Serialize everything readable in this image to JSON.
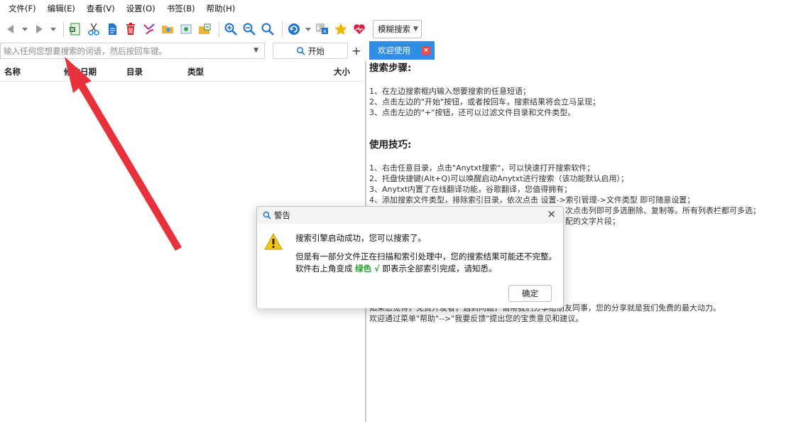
{
  "menu": [
    "文件(F)",
    "编辑(E)",
    "查看(V)",
    "设置(O)",
    "书签(B)",
    "帮助(H)"
  ],
  "toolbar": {
    "mode_select": "模糊搜索"
  },
  "search": {
    "placeholder": "输入任何您想要搜索的词语，然后按回车键。",
    "start_label": "开始",
    "plus_label": "+"
  },
  "tab": {
    "label": "欢迎使用"
  },
  "columns": [
    "名称",
    "修改日期",
    "目录",
    "类型",
    "大小"
  ],
  "welcome": {
    "heading1": "搜索步骤:",
    "steps": [
      "1、在左边搜索框内输入想要搜索的任意短语；",
      "2、点击左边的\"开始\"按钮，或者按回车，搜索结果将会立马呈现；",
      "3、点击左边的\"+\"按钮，还可以过滤文件目录和文件类型。"
    ],
    "heading2": "使用技巧:",
    "tips": [
      "1、右击任意目录，点击\"Anytxt搜索\"，可以快速打开搜索软件；",
      "2、托盘快捷键(Alt+Q)可以唤醒启动Anytxt进行搜索（该功能默认启用）；",
      "3、Anytxt内置了在线翻译功能，谷歌翻译，您值得拥有；",
      "4、添加搜索文件类型，排除索引目录，依次点击 设置->索引管理->文件类型 即可随意设置；",
      "次点击列即可多选删除、复制等。所有列表栏都可多选；",
      "配的文字片段；"
    ],
    "footer": [
      "如果您觉得，免费开发者，遇到问题，请帮我们分享给朋友同事，您的分享就是我们免费的最大动力。",
      "欢迎通过菜单\"帮助\"-->\"我要反馈\"提出您的宝贵意见和建议。"
    ]
  },
  "dialog": {
    "title": "警告",
    "close": "×",
    "line1": "搜索引擎启动成功，您可以搜索了。",
    "line2": "但是有一部分文件正在扫描和索引处理中，您的搜索结果可能还不完整。",
    "line3_pre": "软件右上角变成",
    "line3_green": "绿色 √",
    "line3_post": "即表示全部索引完成，请知悉。",
    "ok_label": "确定"
  }
}
